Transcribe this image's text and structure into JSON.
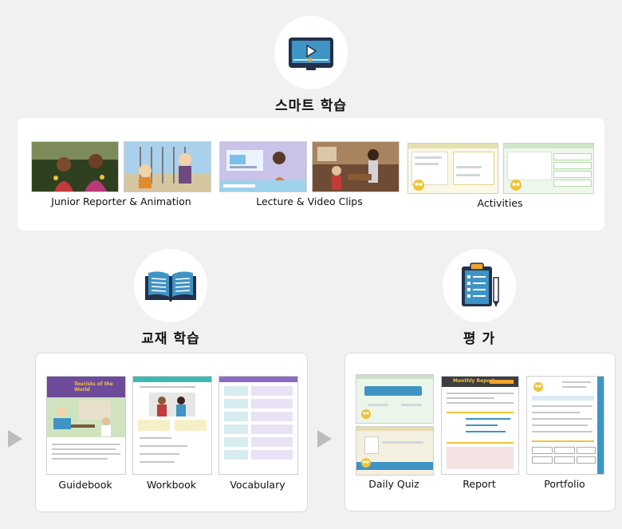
{
  "smart": {
    "title": "스마트 학습",
    "icon": "video-player-icon",
    "groups": [
      "Junior Reporter & Animation",
      "Lecture & Video Clips",
      "Activities"
    ]
  },
  "textbook": {
    "title": "교재 학습",
    "icon": "open-book-icon",
    "items": [
      "Guidebook",
      "Workbook",
      "Vocabulary"
    ],
    "guidebook_cover_title": "Tourists of the World"
  },
  "evaluation": {
    "title": "평 가",
    "icon": "clipboard-pencil-icon",
    "items": [
      "Daily Quiz",
      "Report",
      "Portfolio"
    ],
    "report_header": "Monthly Report"
  },
  "colors": {
    "icon_blue": "#3e94c4",
    "icon_dark": "#24304a",
    "accent_orange": "#f0a52a"
  }
}
